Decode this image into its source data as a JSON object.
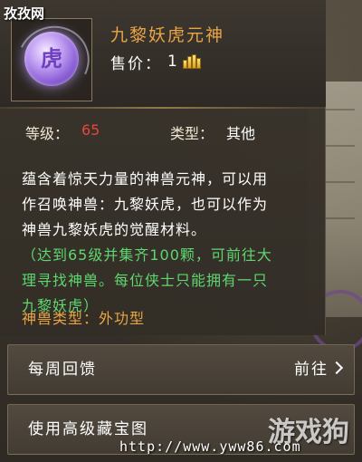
{
  "watermark": {
    "site_name": "孜孜网",
    "url": "http://www.yww86.com",
    "logo_text": "游戏狗"
  },
  "item": {
    "name": "九黎妖虎元神",
    "icon_glyph": "虎",
    "icon_name": "beast-spirit-orb-icon",
    "price_label": "售价：",
    "price_value": "1",
    "currency_icon": "gold-ingot-icon"
  },
  "stats": {
    "level_label": "等级：",
    "level_value": "65",
    "type_label": "类型：",
    "type_value": "其他"
  },
  "description": {
    "lines": [
      "蕴含着惊天力量的神兽元神，可以用",
      "作召唤神兽：九黎妖虎，也可以作为",
      "神兽九黎妖虎的觉醒材料。"
    ]
  },
  "note": {
    "lines": [
      "（达到65级并集齐100颗，可前往大",
      "理寻找神兽。每位侠士只能拥有一只",
      "九黎妖虎）"
    ]
  },
  "beast_type": "神兽类型：外功型",
  "actions": {
    "weekly_feedback_label": "每周回馈",
    "go_label": "前往",
    "treasure_map_label": "使用高级藏宝图"
  },
  "colors": {
    "item_name": "#e8a545",
    "level_value": "#e8453a",
    "note": "#5fd66f",
    "orb": "#8b5fd6"
  }
}
